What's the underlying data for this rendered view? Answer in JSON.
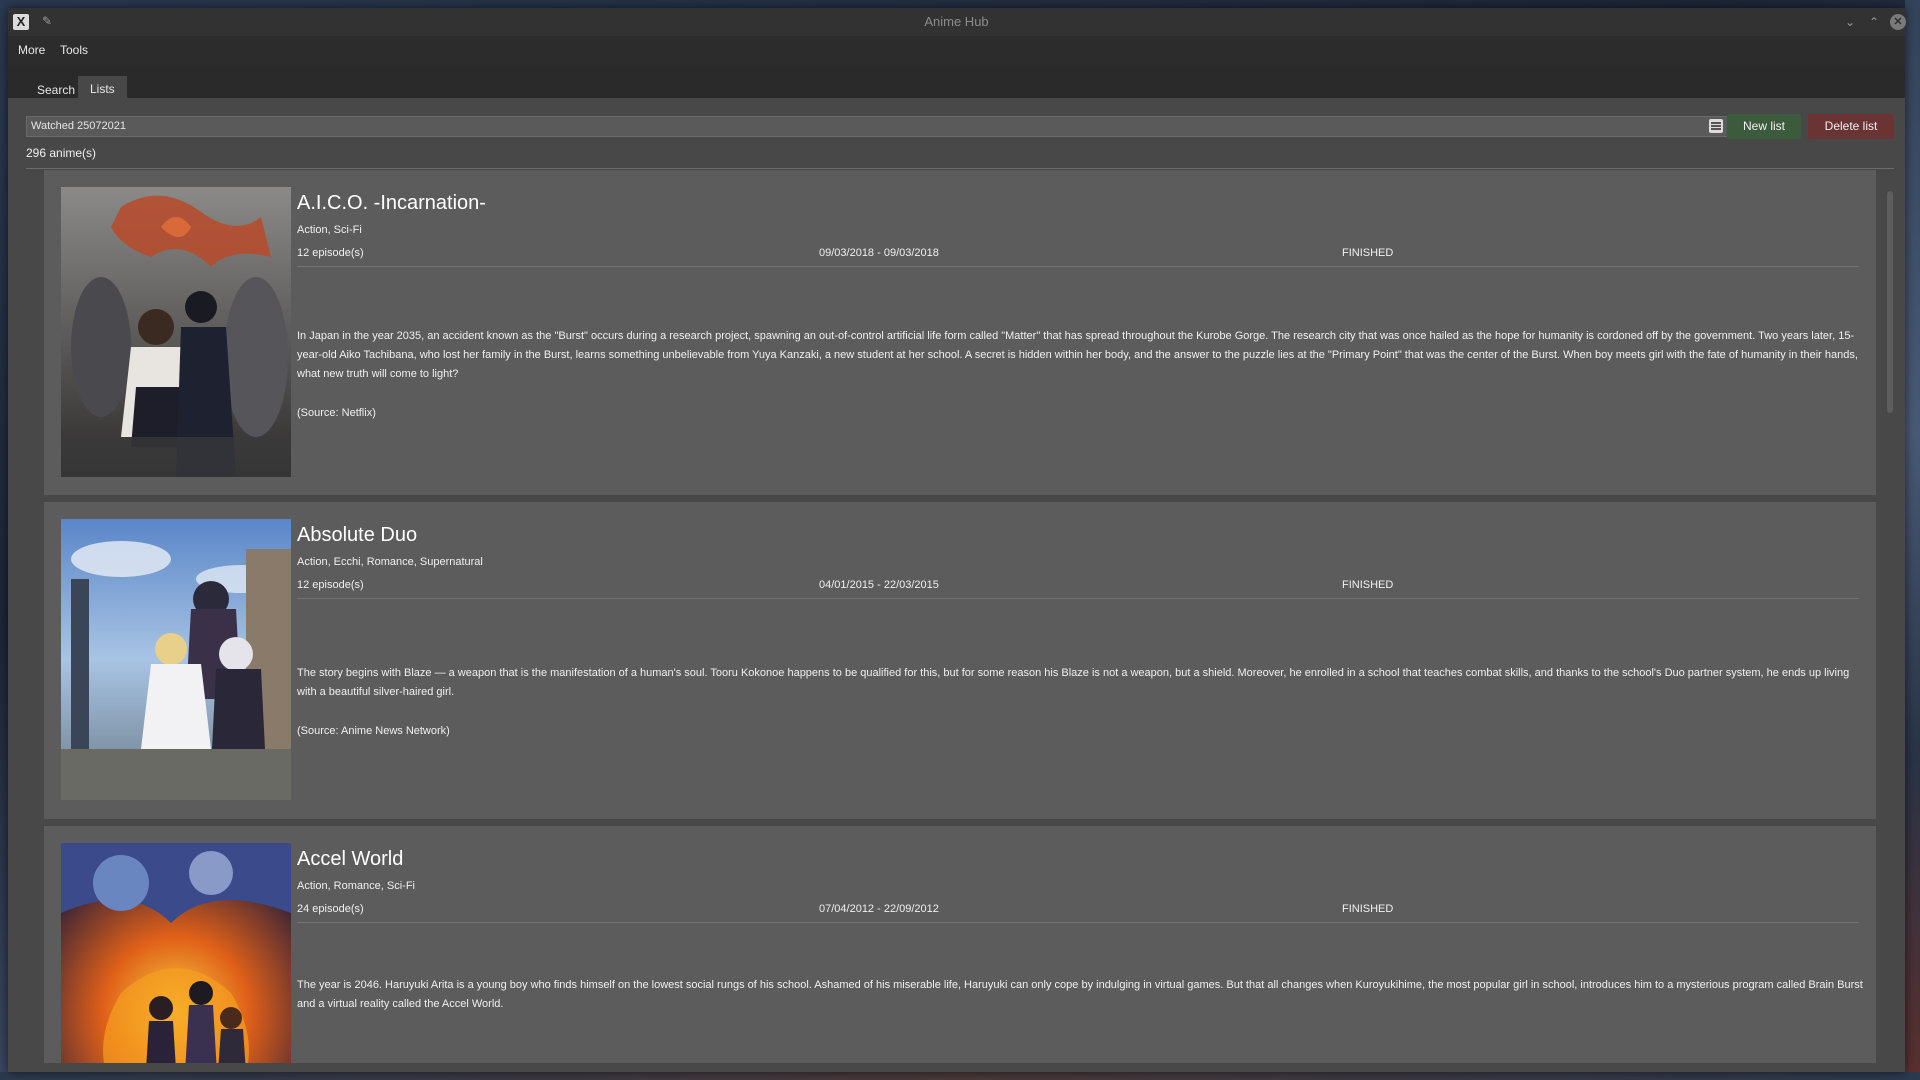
{
  "window": {
    "title": "Anime Hub",
    "app_icon": "X",
    "pin_icon": "pin-icon",
    "minimize_icon": "chevron-down-icon",
    "maximize_icon": "chevron-up-icon",
    "close_icon": "close-icon"
  },
  "menubar": {
    "items": [
      {
        "label": "More"
      },
      {
        "label": "Tools"
      }
    ]
  },
  "tabs": [
    {
      "label": "Search"
    },
    {
      "label": "Lists"
    }
  ],
  "lists_panel": {
    "selected_list": "Watched 25072021",
    "new_list_label": "New list",
    "delete_list_label": "Delete list",
    "count_label": "296 anime(s)"
  },
  "colors": {
    "new_button": "#3c5a3c",
    "delete_button": "#6a3434",
    "card_background": "#5c5c5c",
    "panel_background": "#484848"
  },
  "anime": [
    {
      "title": "A.I.C.O. -Incarnation-",
      "genres": "Action, Sci-Fi",
      "episodes": "12 episode(s)",
      "dates": "09/03/2018 - 09/03/2018",
      "status": "FINISHED",
      "synopsis": "In Japan in the year 2035, an accident known as the \"Burst\" occurs during a research project, spawning an out-of-control artificial life form called \"Matter\" that has spread throughout the Kurobe Gorge. The research city that was once hailed as the hope for humanity is cordoned off by the government. Two years later, 15-year-old Aiko Tachibana, who lost her family in the Burst, learns something unbelievable from Yuya Kanzaki, a new student at her school. A secret is hidden within her body, and the answer to the puzzle lies at the \"Primary Point\" that was the center of the Burst. When boy meets girl with the fate of humanity in their hands, what new truth will come to light?",
      "source": "(Source: Netflix)"
    },
    {
      "title": "Absolute Duo",
      "genres": "Action, Ecchi, Romance, Supernatural",
      "episodes": "12 episode(s)",
      "dates": "04/01/2015 - 22/03/2015",
      "status": "FINISHED",
      "synopsis": "The story begins with Blaze — a weapon that is the manifestation of a human's soul. Tooru Kokonoe happens to be qualified for this, but for some reason his Blaze is not a weapon, but a shield. Moreover, he enrolled in a school that teaches combat skills, and thanks to the school's Duo partner system, he ends up living with a beautiful silver-haired girl.",
      "source": "(Source: Anime News Network)"
    },
    {
      "title": "Accel World",
      "genres": "Action, Romance, Sci-Fi",
      "episodes": "24 episode(s)",
      "dates": "07/04/2012 - 22/09/2012",
      "status": "FINISHED",
      "synopsis": "The year is 2046. Haruyuki Arita is a young boy who finds himself on the lowest social rungs of his school. Ashamed of his miserable life, Haruyuki can only cope by indulging in virtual games. But that all changes when Kuroyukihime, the most popular girl in school, introduces him to a mysterious program called Brain Burst and a virtual reality called the Accel World."
    }
  ]
}
